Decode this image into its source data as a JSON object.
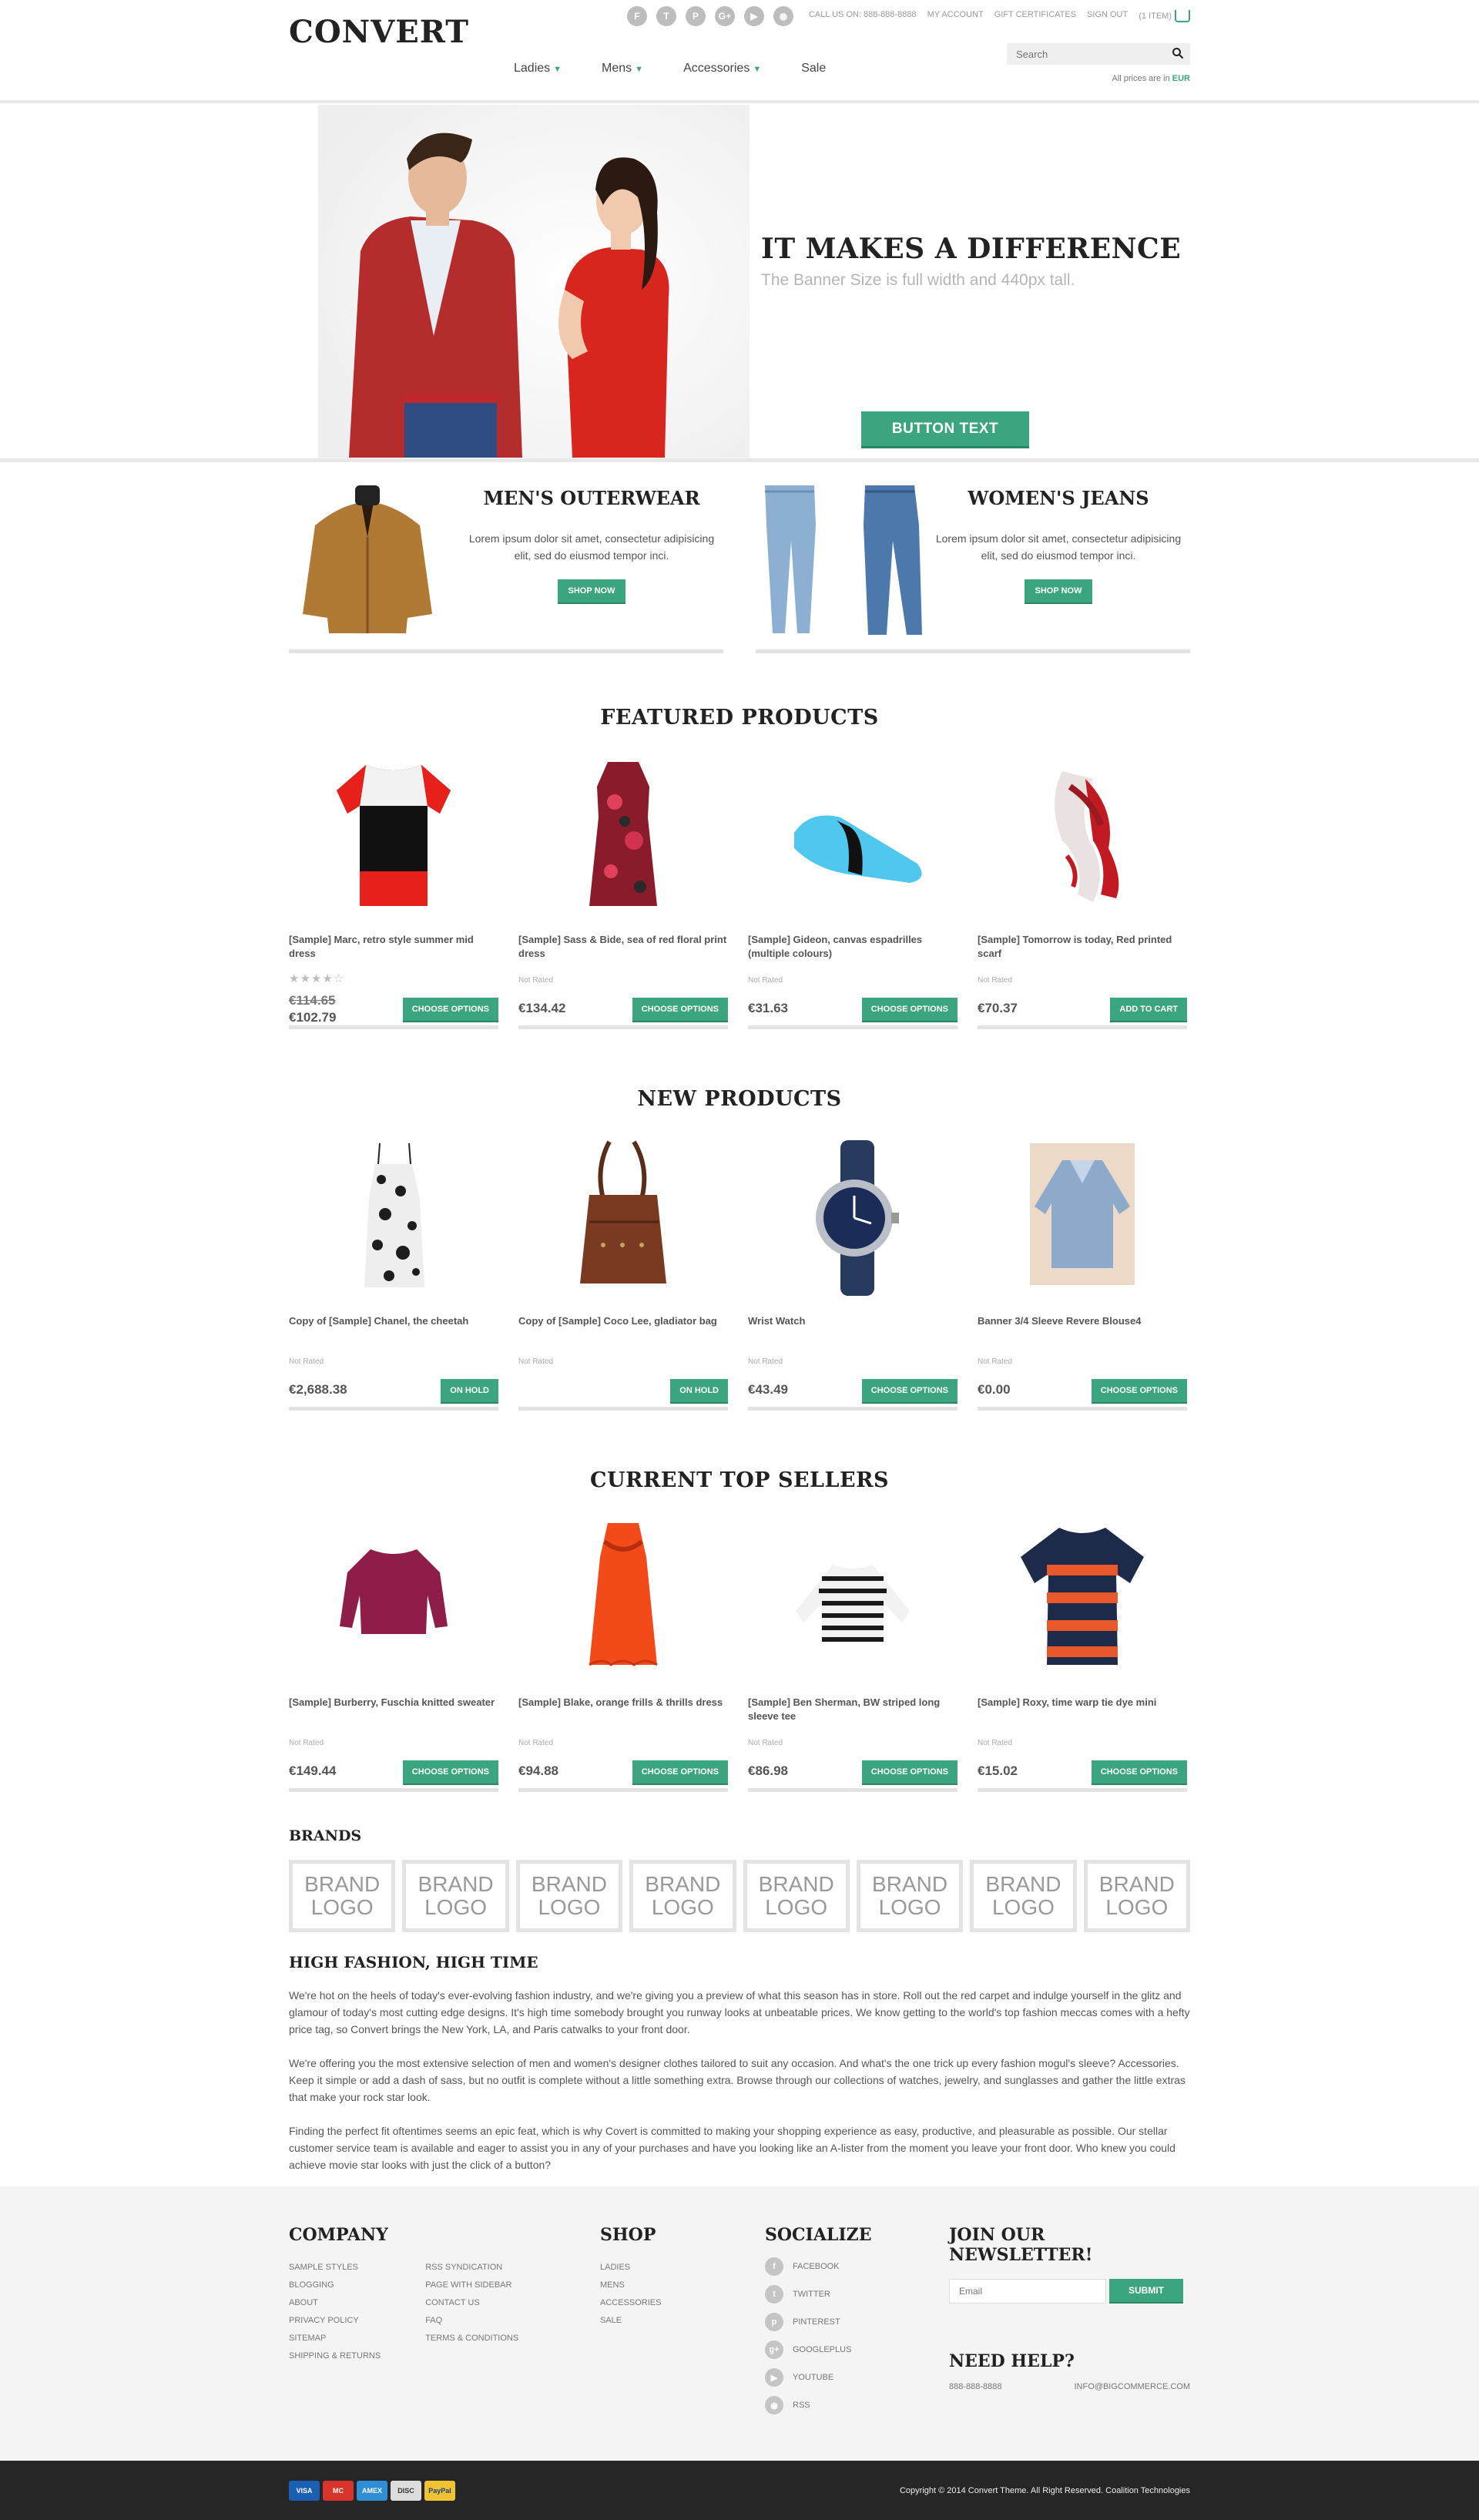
{
  "header": {
    "logo": "CONVERT",
    "call_us": "CALL US ON: 888-888-8888",
    "my_account": "MY ACCOUNT",
    "gift_certificates": "GIFT CERTIFICATES",
    "sign_out": "SIGN OUT",
    "cart": "(1 ITEM)",
    "nav": [
      {
        "label": "Ladies",
        "has_dropdown": true
      },
      {
        "label": "Mens",
        "has_dropdown": true
      },
      {
        "label": "Accessories",
        "has_dropdown": true
      },
      {
        "label": "Sale",
        "has_dropdown": false
      }
    ],
    "search_placeholder": "Search",
    "prices_prefix": "All prices are in",
    "currency": "EUR",
    "social_icons": [
      "facebook-icon",
      "twitter-icon",
      "pinterest-icon",
      "googleplus-icon",
      "youtube-icon",
      "rss-icon"
    ]
  },
  "hero": {
    "title": "IT MAKES A DIFFERENCE",
    "subtitle": "The Banner Size is full width and 440px tall.",
    "button": "BUTTON TEXT"
  },
  "promos": [
    {
      "title": "MEN'S OUTERWEAR",
      "text": "Lorem ipsum dolor sit amet, consectetur adipisicing elit, sed do eiusmod tempor inci.",
      "button": "SHOP NOW"
    },
    {
      "title": "WOMEN'S JEANS",
      "text": "Lorem ipsum dolor sit amet, consectetur adipisicing elit, sed do eiusmod tempor inci.",
      "button": "SHOP NOW"
    }
  ],
  "featured": {
    "title": "FEATURED PRODUCTS",
    "items": [
      {
        "name": "[Sample] Marc, retro style summer mid dress",
        "rating": "",
        "stars": "★★★★☆",
        "price_old": "€114.65",
        "price": "€102.79",
        "button": "CHOOSE OPTIONS"
      },
      {
        "name": "[Sample] Sass & Bide, sea of red floral print dress",
        "rating": "Not Rated",
        "price": "€134.42",
        "button": "CHOOSE OPTIONS"
      },
      {
        "name": "[Sample] Gideon, canvas espadrilles (multiple colours)",
        "rating": "Not Rated",
        "price": "€31.63",
        "button": "CHOOSE OPTIONS"
      },
      {
        "name": "[Sample] Tomorrow is today, Red printed scarf",
        "rating": "Not Rated",
        "price": "€70.37",
        "button": "ADD TO CART"
      }
    ]
  },
  "new_products": {
    "title": "NEW PRODUCTS",
    "items": [
      {
        "name": "Copy of [Sample] Chanel, the cheetah",
        "rating": "Not Rated",
        "price": "€2,688.38",
        "button": "ON HOLD"
      },
      {
        "name": "Copy of [Sample] Coco Lee, gladiator bag",
        "rating": "Not Rated",
        "price": "",
        "button": "ON HOLD"
      },
      {
        "name": "Wrist Watch",
        "rating": "Not Rated",
        "price": "€43.49",
        "button": "CHOOSE OPTIONS"
      },
      {
        "name": "Banner 3/4 Sleeve Revere Blouse4",
        "rating": "Not Rated",
        "price": "€0.00",
        "button": "CHOOSE OPTIONS"
      }
    ]
  },
  "top_sellers": {
    "title": "CURRENT TOP SELLERS",
    "items": [
      {
        "name": "[Sample] Burberry, Fuschia knitted sweater",
        "rating": "Not Rated",
        "price": "€149.44",
        "button": "CHOOSE OPTIONS"
      },
      {
        "name": "[Sample] Blake, orange frills & thrills dress",
        "rating": "Not Rated",
        "price": "€94.88",
        "button": "CHOOSE OPTIONS"
      },
      {
        "name": "[Sample] Ben Sherman, BW striped long sleeve tee",
        "rating": "Not Rated",
        "price": "€86.98",
        "button": "CHOOSE OPTIONS"
      },
      {
        "name": "[Sample] Roxy, time warp tie dye mini",
        "rating": "Not Rated",
        "price": "€15.02",
        "button": "CHOOSE OPTIONS"
      }
    ]
  },
  "brands": {
    "title": "BRANDS",
    "logo_text_1": "BRAND",
    "logo_text_2": "LOGO",
    "count": 8
  },
  "about": {
    "title": "HIGH FASHION, HIGH TIME",
    "paragraphs": [
      "We're hot on the heels of today's ever-evolving fashion industry, and we're giving you a preview of what this season has in store. Roll out the red carpet and indulge yourself in the glitz and glamour of today's most cutting edge designs. It's high time somebody brought you runway looks at unbeatable prices. We know getting to the world's top fashion meccas comes with a hefty price tag, so Convert brings the New York, LA, and Paris catwalks to your front door.",
      "We're offering you the most extensive selection of men and women's designer clothes tailored to suit any occasion. And what's the one trick up every fashion mogul's sleeve? Accessories. Keep it simple or add a dash of sass, but no outfit is complete without a little something extra. Browse through our collections of watches, jewelry, and sunglasses and gather the little extras that make your rock star look.",
      "Finding the perfect fit oftentimes seems an epic feat, which is why Covert is committed to making your shopping experience as easy, productive, and pleasurable as possible. Our stellar customer service team is available and eager to assist you in any of your purchases and have you looking like an A-lister from the moment you leave your front door. Who knew you could achieve movie star looks with just the click of a button?"
    ]
  },
  "footer": {
    "company_title": "COMPANY",
    "company_col1": [
      "SAMPLE STYLES",
      "BLOGGING",
      "ABOUT",
      "PRIVACY POLICY",
      "SITEMAP",
      "SHIPPING & RETURNS"
    ],
    "company_col2": [
      "RSS SYNDICATION",
      "PAGE WITH SIDEBAR",
      "CONTACT US",
      "FAQ",
      "TERMS & CONDITIONS"
    ],
    "shop_title": "SHOP",
    "shop_links": [
      "LADIES",
      "MENS",
      "ACCESSORIES",
      "SALE"
    ],
    "socialize_title": "SOCIALIZE",
    "social_links": [
      {
        "label": "FACEBOOK",
        "glyph": "f"
      },
      {
        "label": "TWITTER",
        "glyph": "t"
      },
      {
        "label": "PINTEREST",
        "glyph": "p"
      },
      {
        "label": "GOOGLEPLUS",
        "glyph": "g+"
      },
      {
        "label": "YOUTUBE",
        "glyph": "▶"
      },
      {
        "label": "RSS",
        "glyph": "◉"
      }
    ],
    "newsletter_title": "JOIN OUR NEWSLETTER!",
    "email_placeholder": "Email",
    "submit": "SUBMIT",
    "help_title": "NEED HELP?",
    "phone": "888-888-8888",
    "email": "INFO@BIGCOMMERCE.COM"
  },
  "bottom": {
    "payments": [
      "VISA",
      "MC",
      "AMEX",
      "DISC",
      "PayPal"
    ],
    "copyright": "Copyright © 2014 Convert Theme. All Right Reserved. Coalition Technologies"
  },
  "colors": {
    "accent": "#3aa57e",
    "footer_bg": "#f4f4f4",
    "bottom_bg": "#262626"
  }
}
